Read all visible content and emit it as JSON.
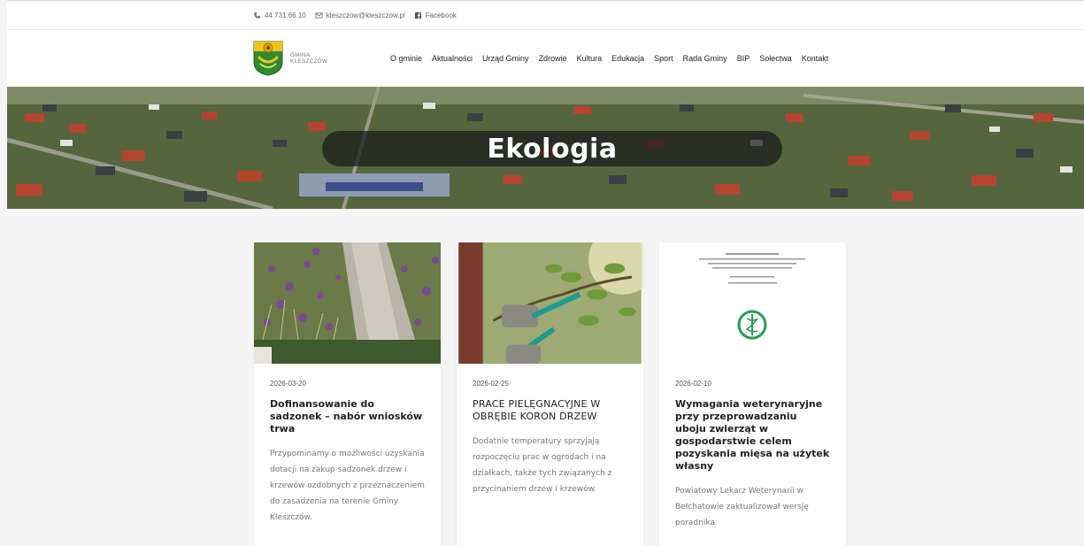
{
  "topbar": {
    "phone": "44 731 66 10",
    "email": "kleszczow@kleszczow.pl",
    "facebook": "Facebook"
  },
  "logo": {
    "line1": "GMINA",
    "line2": "KLESZCZÓW"
  },
  "menu": [
    "O gminie",
    "Aktualności",
    "Urząd Gminy",
    "Zdrowie",
    "Kultura",
    "Edukacja",
    "Sport",
    "Rada Gminy",
    "BIP",
    "Sołectwa",
    "Kontakt"
  ],
  "hero": {
    "title": "Ekologia"
  },
  "cards": [
    {
      "date": "2026-03-20",
      "title": "Dofinansowanie do sadzonek – nabór wniosków trwa",
      "excerpt": "Przypominamy o możliwości uzyskania dotacji na zakup sadzonek drzew i krzewów ozdobnych z przeznaczeniem do zasadzenia na terenie Gminy Kleszczów.",
      "image": "garden-path-photo"
    },
    {
      "date": "2026-02-25",
      "title": "PRACE PIELĘGNACYJNE W OBRĘBIE KORON DRZEW",
      "excerpt": "Dodatnie temperatury sprzyjają rozpoczęciu prac w ogrodach i na działkach, także tych związanych z przycinaniem drzew i krzewów.",
      "image": "pruning-shears-photo"
    },
    {
      "date": "2026-02-10",
      "title": "Wymagania weterynaryjne przy przeprowadzaniu uboju zwierząt w gospodarstwie celem pozyskania mięsa na użytek własny",
      "excerpt": "Powiatowy Lekarz Weterynarii w Bełchatowie zaktualizował wersję poradnika",
      "image": "veterinary-document-thumbnail"
    }
  ],
  "colors": {
    "hero_box": "#191919",
    "background": "#f4f4f4",
    "card": "#ffffff"
  }
}
